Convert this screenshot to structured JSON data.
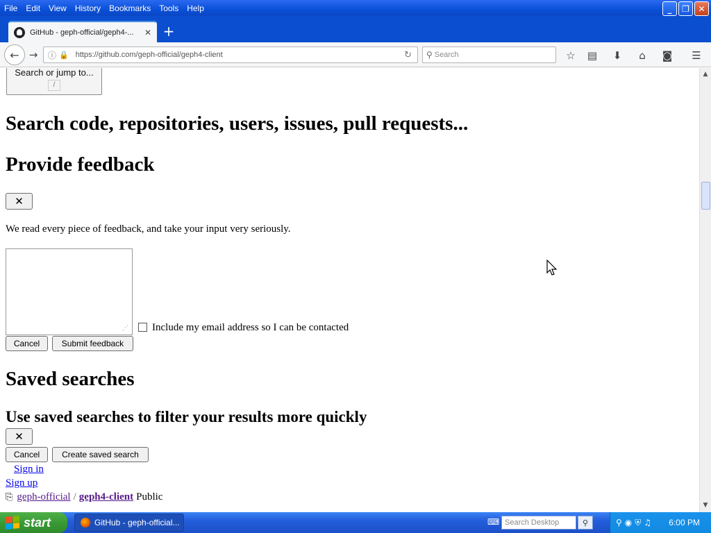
{
  "browser": {
    "menu": [
      "File",
      "Edit",
      "View",
      "History",
      "Bookmarks",
      "Tools",
      "Help"
    ],
    "tab_title": "GitHub - geph-official/geph4-...",
    "url": "https://github.com/geph-official/geph4-client",
    "search_placeholder": "Search"
  },
  "page": {
    "jump_button": "Search or jump to...",
    "jump_key": "/",
    "heading_search": "Search code, repositories, users, issues, pull requests...",
    "heading_feedback": "Provide feedback",
    "close_glyph": "✕",
    "feedback_text": "We read every piece of feedback, and take your input very seriously.",
    "include_email_label": "Include my email address so I can be contacted",
    "cancel_label": "Cancel",
    "submit_feedback_label": "Submit feedback",
    "heading_saved": "Saved searches",
    "subheading_saved": "Use saved searches to filter your results more quickly",
    "create_saved_label": "Create saved search",
    "sign_in": "Sign in",
    "sign_up": "Sign up",
    "repo_owner": "geph-official",
    "repo_sep": "/",
    "repo_name": "geph4-client",
    "repo_visibility": "Public"
  },
  "taskbar": {
    "start_label": "start",
    "task_item_label": "GitHub - geph-official...",
    "desktop_search_placeholder": "Search Desktop",
    "clock": "6:00 PM"
  }
}
